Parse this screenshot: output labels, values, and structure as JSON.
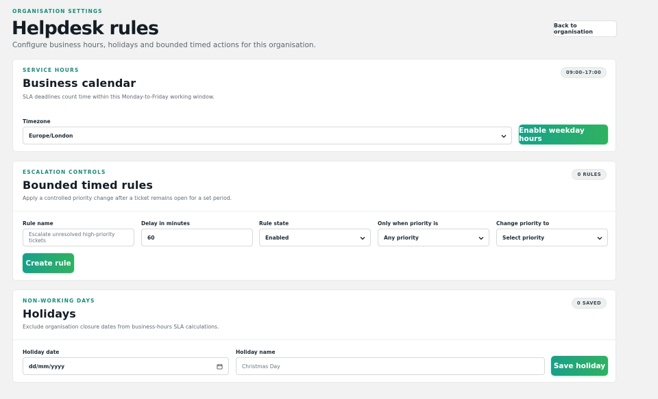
{
  "header": {
    "eyebrow": "ORGANISATION SETTINGS",
    "title": "Helpdesk rules",
    "subtitle": "Configure business hours, holidays and bounded timed actions for this organisation.",
    "back_label": "Back to organisation"
  },
  "business": {
    "eyebrow": "SERVICE HOURS",
    "title": "Business calendar",
    "description": "SLA deadlines count time within this Monday-to-Friday working window.",
    "badge": "09:00–17:00",
    "timezone_label": "Timezone",
    "timezone_value": "Europe/London",
    "action_label": "Enable weekday hours"
  },
  "escalation": {
    "eyebrow": "ESCALATION CONTROLS",
    "title": "Bounded timed rules",
    "description": "Apply a controlled priority change after a ticket remains open for a set period.",
    "badge": "0 RULES",
    "rule_name_label": "Rule name",
    "rule_name_placeholder": "Escalate unresolved high-priority tickets",
    "delay_label": "Delay in minutes",
    "delay_value": "60",
    "state_label": "Rule state",
    "state_value": "Enabled",
    "only_priority_label": "Only when priority is",
    "only_priority_value": "Any priority",
    "change_priority_label": "Change priority to",
    "change_priority_value": "Select priority",
    "create_label": "Create rule"
  },
  "holidays": {
    "eyebrow": "NON-WORKING DAYS",
    "title": "Holidays",
    "description": "Exclude organisation closure dates from business-hours SLA calculations.",
    "badge": "0 SAVED",
    "date_label": "Holiday date",
    "date_value": "dd/mm/yyyy",
    "name_label": "Holiday name",
    "name_placeholder": "Christmas Day",
    "save_label": "Save holiday"
  },
  "icons": {
    "select_arrow": "chevron-down-icon",
    "date_picker": "calendar-icon"
  },
  "colors": {
    "accent": "#1b8a7a",
    "button_start": "#18a08a",
    "button_end": "#2fb261",
    "background": "#f1f2f1"
  }
}
